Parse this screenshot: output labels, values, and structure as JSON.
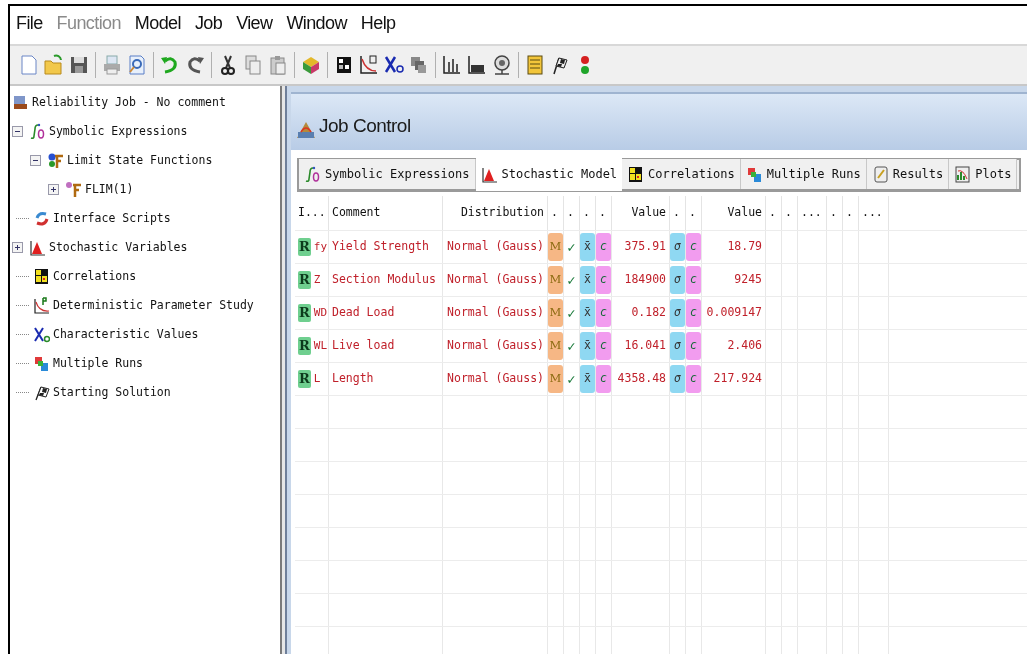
{
  "menu": [
    {
      "label": "File",
      "disabled": false
    },
    {
      "label": "Function",
      "disabled": true
    },
    {
      "label": "Model",
      "disabled": false
    },
    {
      "label": "Job",
      "disabled": false
    },
    {
      "label": "View",
      "disabled": false
    },
    {
      "label": "Window",
      "disabled": false
    },
    {
      "label": "Help",
      "disabled": false
    }
  ],
  "tree": [
    {
      "label": "Reliability Job - No comment",
      "kind": "job",
      "children": [
        {
          "label": "Symbolic Expressions",
          "kind": "integral",
          "expanded": true,
          "children": [
            {
              "label": "Limit State Functions",
              "kind": "function",
              "expanded": true,
              "children": [
                {
                  "label": "FLIM(1)",
                  "kind": "subfunction",
                  "expanded": false
                }
              ]
            }
          ]
        },
        {
          "label": "Interface Scripts",
          "kind": "script"
        },
        {
          "label": "Stochastic Variables",
          "kind": "distribution",
          "expanded": false
        },
        {
          "label": "Correlations",
          "kind": "matrix"
        },
        {
          "label": "Deterministic Parameter Study",
          "kind": "curve"
        },
        {
          "label": "Characteristic Values",
          "kind": "xc"
        },
        {
          "label": "Multiple Runs",
          "kind": "runs"
        },
        {
          "label": "Starting Solution",
          "kind": "flag"
        }
      ]
    }
  ],
  "job_control": {
    "title": "Job Control",
    "tabs": [
      {
        "label": "Symbolic Expressions",
        "kind": "integral",
        "selected": false
      },
      {
        "label": "Stochastic Model",
        "kind": "distribution",
        "selected": true
      },
      {
        "label": "Correlations",
        "kind": "matrix",
        "selected": false
      },
      {
        "label": "Multiple Runs",
        "kind": "runs",
        "selected": false
      },
      {
        "label": "Results",
        "kind": "results",
        "selected": false
      },
      {
        "label": "Plots",
        "kind": "plots",
        "selected": false
      }
    ],
    "table": {
      "columns": [
        "I...",
        "Comment",
        "Distribution",
        ".",
        ".",
        ".",
        ".",
        "Value",
        ".",
        ".",
        "Value",
        ".",
        ".",
        "...",
        ".",
        ".",
        "..."
      ],
      "rows": [
        {
          "badge": "R",
          "symbol": "fy",
          "comment": "Yield Strength",
          "distribution": "Normal (Gauss)",
          "flags": [
            "M",
            "✓",
            "x̄",
            "c"
          ],
          "value_1": "375.91",
          "flags_2": [
            "σ",
            "c"
          ],
          "value_2": "18.79"
        },
        {
          "badge": "R",
          "symbol": "Z",
          "comment": "Section Modulus",
          "distribution": "Normal (Gauss)",
          "flags": [
            "M",
            "✓",
            "x̄",
            "c"
          ],
          "value_1": "184900",
          "flags_2": [
            "σ",
            "c"
          ],
          "value_2": "9245"
        },
        {
          "badge": "R",
          "symbol": "WD",
          "comment": "Dead Load",
          "distribution": "Normal (Gauss)",
          "flags": [
            "M",
            "✓",
            "x̄",
            "c"
          ],
          "value_1": "0.182",
          "flags_2": [
            "σ",
            "c"
          ],
          "value_2": "0.009147"
        },
        {
          "badge": "R",
          "symbol": "WL",
          "comment": "Live load",
          "distribution": "Normal (Gauss)",
          "flags": [
            "M",
            "✓",
            "x̄",
            "c"
          ],
          "value_1": "16.041",
          "flags_2": [
            "σ",
            "c"
          ],
          "value_2": "2.406"
        },
        {
          "badge": "R",
          "symbol": "L",
          "comment": "Length",
          "distribution": "Normal (Gauss)",
          "flags": [
            "M",
            "✓",
            "x̄",
            "c"
          ],
          "value_1": "4358.48",
          "flags_2": [
            "σ",
            "c"
          ],
          "value_2": "217.924"
        }
      ]
    }
  }
}
